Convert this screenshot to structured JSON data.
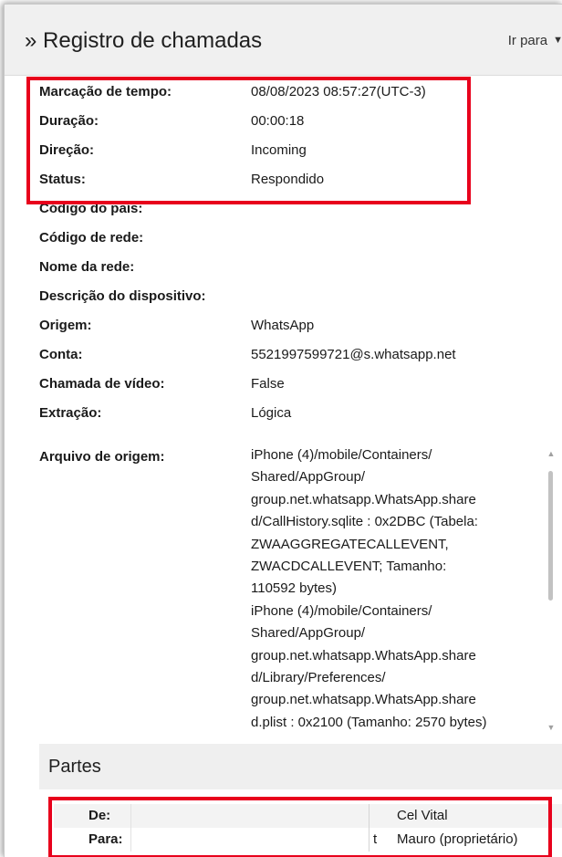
{
  "header": {
    "title": "» Registro de chamadas",
    "goto_label": "Ir para",
    "goto_caret": "▼"
  },
  "properties": [
    {
      "label": "Marcação de tempo:",
      "value": "08/08/2023 08:57:27(UTC-3)"
    },
    {
      "label": "Duração:",
      "value": "00:00:18"
    },
    {
      "label": "Direção:",
      "value": "Incoming"
    },
    {
      "label": "Status:",
      "value": "Respondido"
    },
    {
      "label": "Código do país:",
      "value": ""
    },
    {
      "label": "Código de rede:",
      "value": ""
    },
    {
      "label": "Nome da rede:",
      "value": ""
    },
    {
      "label": "Descrição do dispositivo:",
      "value": ""
    },
    {
      "label": "Origem:",
      "value": "WhatsApp"
    },
    {
      "label": "Conta:",
      "value": "5521997599721@s.whatsapp.net"
    },
    {
      "label": "Chamada de vídeo:",
      "value": "False"
    },
    {
      "label": "Extração:",
      "value": "Lógica"
    }
  ],
  "source_file": {
    "label": "Arquivo de origem:",
    "lines": [
      "iPhone (4)/mobile/Containers/",
      "Shared/AppGroup/",
      "group.net.whatsapp.WhatsApp.share",
      "d/CallHistory.sqlite : 0x2DBC (Tabela:",
      "ZWAAGGREGATECALLEVENT,",
      "ZWACDCALLEVENT; Tamanho:",
      "110592 bytes)",
      "iPhone (4)/mobile/Containers/",
      "Shared/AppGroup/",
      "group.net.whatsapp.WhatsApp.share",
      "d/Library/Preferences/",
      "group.net.whatsapp.WhatsApp.share",
      "d.plist : 0x2100 (Tamanho: 2570 bytes)"
    ],
    "scroll_up": "▲",
    "scroll_down": "▼"
  },
  "parties": {
    "title": "Partes",
    "rows": [
      {
        "label": "De:",
        "identifier": "",
        "cut": "",
        "name": "Cel Vital"
      },
      {
        "label": "Para:",
        "identifier": "",
        "cut": "t",
        "name": "Mauro (proprietário)"
      }
    ]
  },
  "colors": {
    "highlight": "#e8001c",
    "header_bg": "#f0f0f0"
  }
}
